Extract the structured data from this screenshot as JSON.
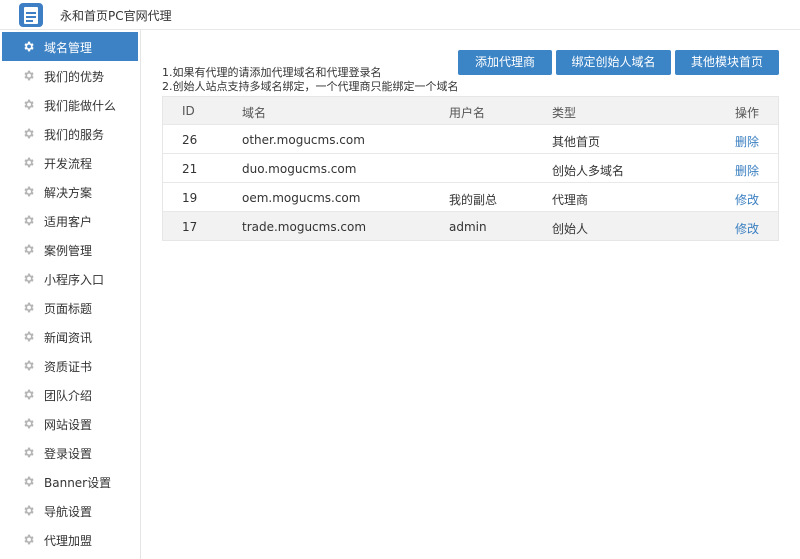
{
  "app": {
    "title": "永和首页PC官网代理",
    "logo_icon": "document-logo-icon",
    "accent": "#3d82c4"
  },
  "sidebar": {
    "items": [
      {
        "label": "域名管理",
        "active": true
      },
      {
        "label": "我们的优势"
      },
      {
        "label": "我们能做什么"
      },
      {
        "label": "我们的服务"
      },
      {
        "label": "开发流程"
      },
      {
        "label": "解决方案"
      },
      {
        "label": "适用客户"
      },
      {
        "label": "案例管理"
      },
      {
        "label": "小程序入口"
      },
      {
        "label": "页面标题"
      },
      {
        "label": "新闻资讯"
      },
      {
        "label": "资质证书"
      },
      {
        "label": "团队介绍"
      },
      {
        "label": "网站设置"
      },
      {
        "label": "登录设置"
      },
      {
        "label": "Banner设置"
      },
      {
        "label": "导航设置"
      },
      {
        "label": "代理加盟"
      }
    ],
    "icon": "gear-icon"
  },
  "toolbar": {
    "add_agent": "添加代理商",
    "bind_founder": "绑定创始人域名",
    "other_home": "其他模块首页"
  },
  "notes": {
    "line1": "1.如果有代理的请添加代理域名和代理登录名",
    "line2": "2.创始人站点支持多域名绑定，一个代理商只能绑定一个域名"
  },
  "table": {
    "columns": {
      "id": "ID",
      "domain": "域名",
      "user": "用户名",
      "type": "类型",
      "op": "操作"
    },
    "rows": [
      {
        "id": "26",
        "domain": "other.mogucms.com",
        "user": "",
        "type": "其他首页",
        "op": "删除"
      },
      {
        "id": "21",
        "domain": "duo.mogucms.com",
        "user": "",
        "type": "创始人多域名",
        "op": "删除"
      },
      {
        "id": "19",
        "domain": "oem.mogucms.com",
        "user": "我的副总",
        "type": "代理商",
        "op": "修改"
      },
      {
        "id": "17",
        "domain": "trade.mogucms.com",
        "user": "admin",
        "type": "创始人",
        "op": "修改"
      }
    ]
  }
}
